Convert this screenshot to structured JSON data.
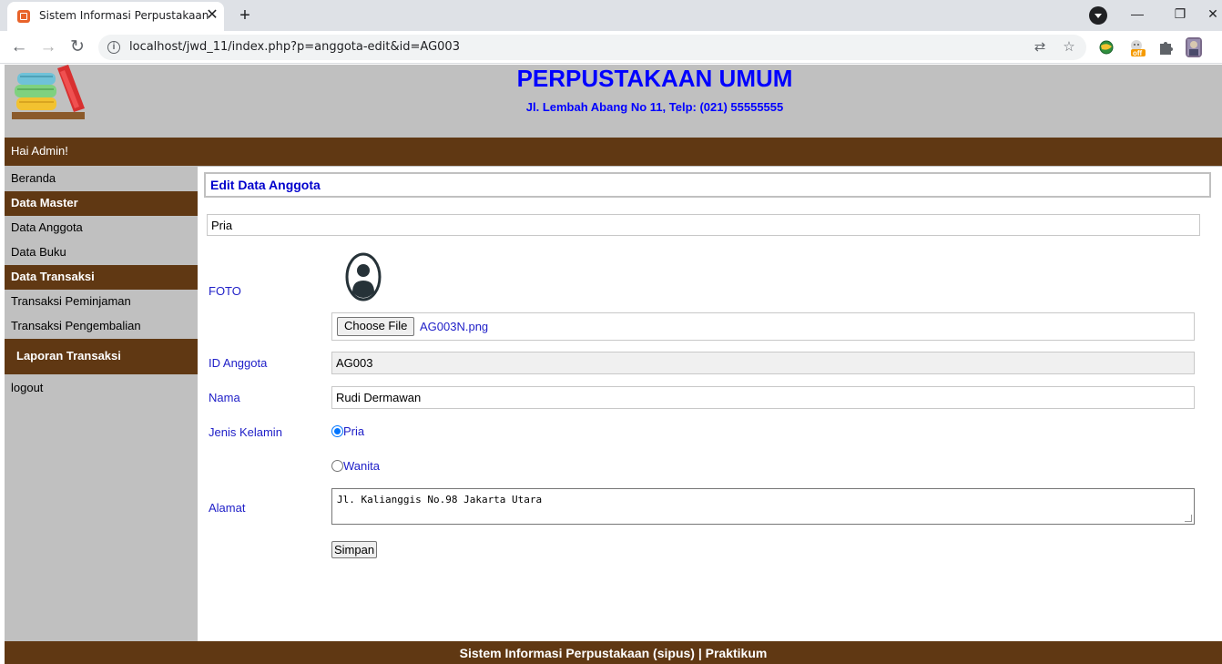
{
  "browser": {
    "tab_title": "Sistem Informasi Perpustakaan",
    "tab_close": "✕",
    "new_tab": "+",
    "url": "localhost/jwd_11/index.php?p=anggota-edit&id=AG003",
    "win_minimize": "—",
    "win_restore": "❐",
    "win_close": "✕",
    "back": "←",
    "forward": "→",
    "reload": "↻",
    "info": "i",
    "translate": "⇄",
    "bookmark": "☆",
    "ext_off_badge": "off"
  },
  "header": {
    "title": "PERPUSTAKAAN UMUM",
    "address": "Jl. Lembah Abang No 11, Telp: (021) 55555555",
    "greeting": "Hai Admin!"
  },
  "sidebar": {
    "beranda": "Beranda",
    "data_master": "Data Master",
    "data_anggota": "Data Anggota",
    "data_buku": "Data Buku",
    "data_transaksi": "Data Transaksi",
    "transaksi_peminjaman": "Transaksi Peminjaman",
    "transaksi_pengembalian": "Transaksi Pengembalian",
    "laporan_transaksi": "Laporan Transaksi",
    "logout": "logout"
  },
  "form": {
    "heading": "Edit Data Anggota",
    "gender_echo": "Pria",
    "foto_label": "FOTO",
    "file_button": "Choose File",
    "file_name": "AG003N.png",
    "id_label": "ID Anggota",
    "id_value": "AG003",
    "nama_label": "Nama",
    "nama_value": "Rudi Dermawan",
    "jk_label": "Jenis Kelamin",
    "jk_pria": "Pria",
    "jk_wanita": "Wanita",
    "jk_selected": "Pria",
    "alamat_label": "Alamat",
    "alamat_value": "Jl. Kalianggis No.98 Jakarta Utara",
    "save_button": "Simpan"
  },
  "footer": {
    "text": "Sistem Informasi Perpustakaan (sipus) | Praktikum"
  },
  "colors": {
    "brown": "#603813",
    "sidebar_bg": "#c0c0c0",
    "title_blue": "#0000ff",
    "label_blue": "#2020c8"
  }
}
